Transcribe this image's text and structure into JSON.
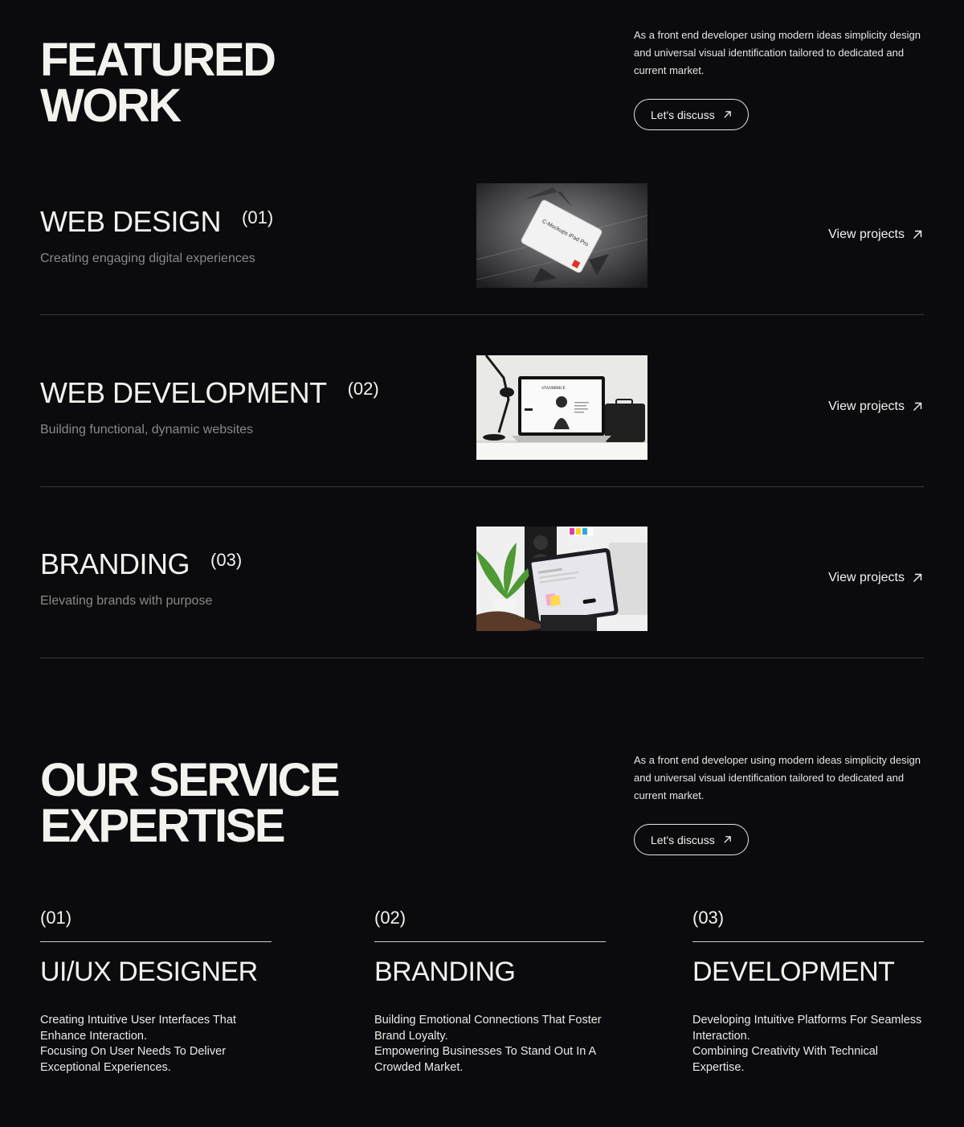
{
  "featured": {
    "title_lines": [
      "FEATURED",
      "WORK"
    ],
    "intro": "As a front end developer using modern ideas simplicity design and universal visual identification tailored to dedicated and current market.",
    "cta_label": "Let's discuss"
  },
  "work_items": [
    {
      "title": "WEB DESIGN",
      "num": "(01)",
      "subtitle": "Creating engaging digital experiences",
      "link": "View projects",
      "thumb_text": "C-Mockups iPad Pro"
    },
    {
      "title": "WEB DEVELOPMENT",
      "num": "(02)",
      "subtitle": "Building functional, dynamic websites",
      "link": "View projects",
      "thumb_text": "STANMMICE"
    },
    {
      "title": "BRANDING",
      "num": "(03)",
      "subtitle": "Elevating brands with purpose",
      "link": "View projects"
    }
  ],
  "services": {
    "title_lines": [
      "OUR SERVICE",
      "EXPERTISE"
    ],
    "intro": "As a front end developer using modern ideas simplicity design and universal visual identification tailored to dedicated and current market.",
    "cta_label": "Let's discuss",
    "items": [
      {
        "num": "(01)",
        "title": "UI/UX DESIGNER",
        "lines": [
          "Creating Intuitive User Interfaces That Enhance Interaction.",
          "Focusing On User Needs To Deliver Exceptional Experiences."
        ]
      },
      {
        "num": "(02)",
        "title": "BRANDING",
        "lines": [
          "Building Emotional Connections That Foster Brand Loyalty.",
          "Empowering Businesses To Stand Out In A Crowded Market."
        ]
      },
      {
        "num": "(03)",
        "title": "DEVELOPMENT",
        "lines": [
          "Developing Intuitive Platforms For Seamless Interaction.",
          "Combining Creativity With Technical Expertise."
        ]
      }
    ]
  },
  "colors": {
    "background": "#0b0b0d",
    "text": "#f4f2ee",
    "muted": "#8a8985",
    "divider": "#3a3a3d"
  },
  "icons": {
    "cta": "arrow-up-right-icon",
    "link": "arrow-up-right-icon"
  }
}
